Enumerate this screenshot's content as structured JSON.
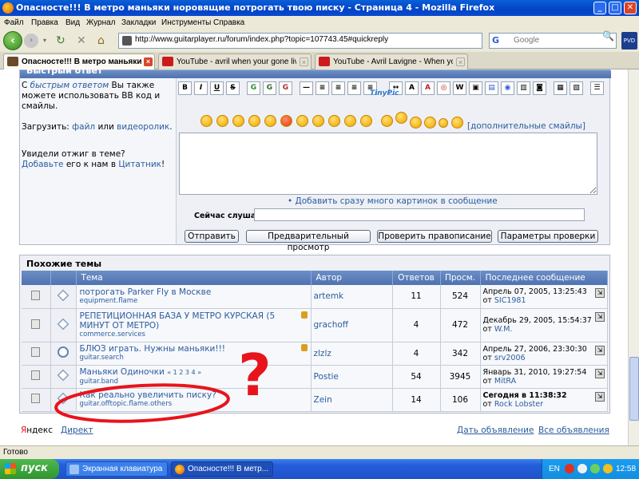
{
  "window": {
    "title": "Опасносте!!! В метро маньяки норовящие потрогать твою писку - Страница 4 - Mozilla Firefox",
    "minimize": "_",
    "maximize": "□",
    "close": "✕"
  },
  "menu": [
    "Файл",
    "Правка",
    "Вид",
    "Журнал",
    "Закладки",
    "Инструменты",
    "Справка"
  ],
  "nav": {
    "url": "http://www.guitarplayer.ru/forum/index.php?topic=107743.45#quickreply",
    "search_placeholder": "Google",
    "pvd": "PVD"
  },
  "tabs": [
    {
      "label": "Опасносте!!! В метро маньяки н...",
      "active": true
    },
    {
      "label": "YouTube - avril when your gone live",
      "active": false
    },
    {
      "label": "YouTube - Avril Lavigne - When you're ...",
      "active": false
    }
  ],
  "quickreply": {
    "header": "Быстрый ответ",
    "intro_pre": "С ",
    "intro_link": "быстрым ответом",
    "intro_post": " Вы также можете использовать BB код и смайлы.",
    "upload_label": "Загрузить: ",
    "upload_file": "файл",
    "upload_or": " или ",
    "upload_video": "видеоролик",
    "upload_end": ".",
    "saw_title": "Увидели отжиг в теме?",
    "saw_add": "Добавьте",
    "saw_mid": " его к нам в ",
    "saw_quotes": "Цитатник",
    "saw_end": "!",
    "toolbar": [
      "B",
      "I",
      "U",
      "S",
      "G",
      "G",
      "G",
      "—",
      "≡",
      "≡",
      "≡",
      "≡",
      "↔",
      "A",
      "A",
      "◎",
      "W",
      "▣",
      "▤",
      "◉",
      "▥",
      "◙",
      "▦",
      "▧",
      "☰"
    ],
    "tinypic": "TinyPic",
    "more_smileys": "[дополнительные смайлы]",
    "add_pics": "• Добавить сразу много картинок в сообщение",
    "listening_label": "Сейчас слушаю:",
    "buttons": {
      "send": "Отправить",
      "preview": "Предварительный просмотр",
      "spell": "Проверить правописание",
      "spell_params": "Параметры проверки"
    }
  },
  "similar": {
    "title": "Похожие темы",
    "columns": [
      "Тема",
      "Автор",
      "Ответов",
      "Просм.",
      "Последнее сообщение"
    ],
    "rows": [
      {
        "title": "потрогать Parker Fly в Москве",
        "forum": "equipment.flame",
        "author": "artemk",
        "replies": "11",
        "views": "524",
        "last_date": "Апрель 07, 2005, 13:25:43",
        "last_from": "от ",
        "last_user": "SIC1981",
        "locked": false,
        "pages": ""
      },
      {
        "title": "РЕПЕТИЦИОННАЯ БАЗА У МЕТРО КУРСКАЯ (5 МИНУТ ОТ МЕТРО)",
        "forum": "commerce.services",
        "author": "grachoff",
        "replies": "4",
        "views": "472",
        "last_date": "Декабрь 29, 2005, 15:54:37",
        "last_from": "от ",
        "last_user": "W.M.",
        "locked": true,
        "pages": ""
      },
      {
        "title": "БЛЮЗ играть. Нужны маньяки!!!",
        "forum": "guitar.search",
        "author": "zlzlz",
        "replies": "4",
        "views": "342",
        "last_date": "Апрель 27, 2006, 23:30:30",
        "last_from": "от ",
        "last_user": "srv2006",
        "locked": true,
        "pages": ""
      },
      {
        "title": "Маньяки Одиночки",
        "forum": "guitar.band",
        "author": "Postie",
        "replies": "54",
        "views": "3945",
        "last_date": "Январь 31, 2010, 19:27:54",
        "last_from": "от ",
        "last_user": "MitRA",
        "locked": false,
        "pages": "« 1 2 3 4 »"
      },
      {
        "title": "Как реально увеличить писку?",
        "forum": "guitar.offtopic.flame.others",
        "author": "Zein",
        "replies": "14",
        "views": "106",
        "last_date": "Сегодня в 11:38:32",
        "last_from": "от ",
        "last_user": "Rock Lobster",
        "locked": false,
        "pages": ""
      }
    ]
  },
  "footer": {
    "yandex_red": "Я",
    "yandex_rest": "ндекс",
    "direct": "Директ",
    "ad": "Дать объявление",
    "all_ads": "Все объявления"
  },
  "annotation": {
    "mark": "?",
    "color": "#e8141c"
  },
  "status": "Готово",
  "taskbar": {
    "start": "пуск",
    "items": [
      "Экранная клавиатура",
      "Опасносте!!! В метр..."
    ],
    "lang": "EN",
    "clock": "12:58"
  }
}
